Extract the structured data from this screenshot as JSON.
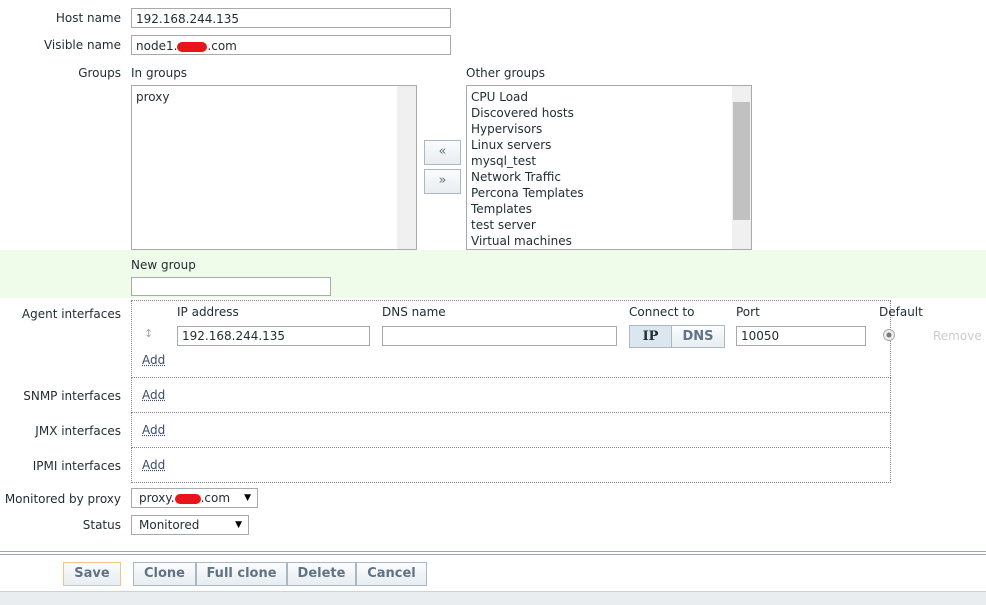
{
  "host_name": {
    "label": "Host name",
    "value": "192.168.244.135"
  },
  "visible_name": {
    "label": "Visible name",
    "prefix": "node1.",
    "suffix": ".com"
  },
  "groups": {
    "label": "Groups",
    "in_label": "In groups",
    "in_groups": [
      "proxy"
    ],
    "other_label": "Other groups",
    "other_groups": [
      "CPU Load",
      "Discovered hosts",
      "Hypervisors",
      "Linux servers",
      "mysql_test",
      "Network Traffic",
      "Percona Templates",
      "Templates",
      "test server",
      "Virtual machines"
    ],
    "add_btn": "«",
    "remove_btn": "»"
  },
  "new_group": {
    "label": "New group",
    "value": ""
  },
  "agent": {
    "label": "Agent interfaces",
    "ip_header": "IP address",
    "dns_header": "DNS name",
    "connect_header": "Connect to",
    "port_header": "Port",
    "default_header": "Default",
    "ip": "192.168.244.135",
    "dns": "",
    "connect_ip": "IP",
    "connect_dns": "DNS",
    "connect_selected": "IP",
    "port": "10050",
    "remove": "Remove",
    "add": "Add"
  },
  "snmp": {
    "label": "SNMP interfaces",
    "add": "Add"
  },
  "jmx": {
    "label": "JMX interfaces",
    "add": "Add"
  },
  "ipmi": {
    "label": "IPMI interfaces",
    "add": "Add"
  },
  "proxy": {
    "label": "Monitored by proxy",
    "prefix": "proxy.",
    "suffix": ".com"
  },
  "status": {
    "label": "Status",
    "value": "Monitored"
  },
  "buttons": {
    "save": "Save",
    "clone": "Clone",
    "full_clone": "Full clone",
    "delete": "Delete",
    "cancel": "Cancel"
  },
  "colors": {
    "green_band": "#eefce9",
    "footer": "#e9edf0",
    "button_text": "#5f7384"
  }
}
